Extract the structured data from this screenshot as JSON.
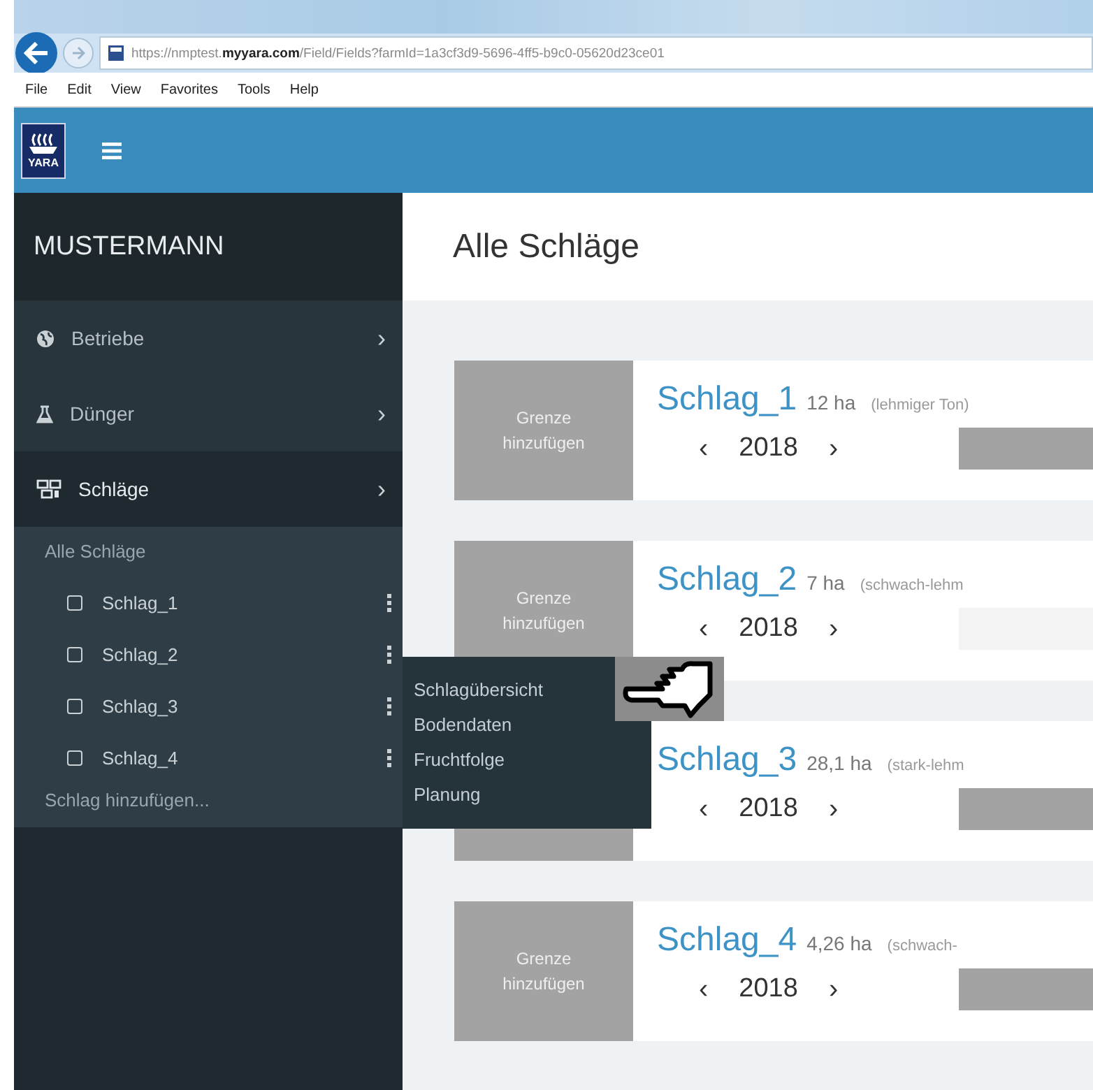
{
  "browser": {
    "url": "https://nmptest.**myyara.com**/Field/Fields?farmId=1a3cf3d9-5696-4ff5-b9c0-05620d23ce01",
    "menu": [
      "File",
      "Edit",
      "View",
      "Favorites",
      "Tools",
      "Help"
    ]
  },
  "app_header": {
    "logo_text": "YARA"
  },
  "sidebar": {
    "account": "MUSTERMANN",
    "items": [
      {
        "label": "Betriebe",
        "kind": "globe",
        "chevron": "›",
        "selected": false
      },
      {
        "label": "Dünger",
        "kind": "flask",
        "chevron": "›",
        "selected": false
      },
      {
        "label": "Schläge",
        "kind": "fields",
        "chevron": "›",
        "selected": true
      }
    ],
    "fields_menu": {
      "header": "Alle Schläge",
      "fields": [
        {
          "label": "Schlag_1",
          "checked": false
        },
        {
          "label": "Schlag_2",
          "checked": false
        },
        {
          "label": "Schlag_3",
          "checked": false
        },
        {
          "label": "Schlag_4",
          "checked": false
        }
      ],
      "add_link": "Schlag hinzufügen..."
    }
  },
  "context_menu": {
    "items": [
      "Schlagübersicht",
      "Bodendaten",
      "Fruchtfolge",
      "Planung"
    ]
  },
  "page": {
    "title": "Alle Schläge",
    "cards": [
      {
        "name": "Schlag_1",
        "area": "12 ha",
        "soil": "(lehmiger Ton)",
        "boundary_button": "Grenze hinzufügen",
        "prev": "‹",
        "year": "2018",
        "next": "›",
        "bar_filled": true
      },
      {
        "name": "Schlag_2",
        "area": "7 ha",
        "soil": "(schwach-lehm",
        "boundary_button": "Grenze hinzufügen",
        "prev": "‹",
        "year": "2018",
        "next": "›",
        "bar_filled": false
      },
      {
        "name": "Schlag_3",
        "area": "28,1 ha",
        "soil": "(stark-lehm",
        "prev": "‹",
        "year": "2018",
        "next": "›",
        "bar_filled": true
      },
      {
        "name": "Schlag_4",
        "area": "4,26 ha",
        "soil": "(schwach-",
        "boundary_button": "Grenze hinzufügen",
        "prev": "‹",
        "year": "2018",
        "next": "›",
        "bar_filled": true
      }
    ]
  }
}
